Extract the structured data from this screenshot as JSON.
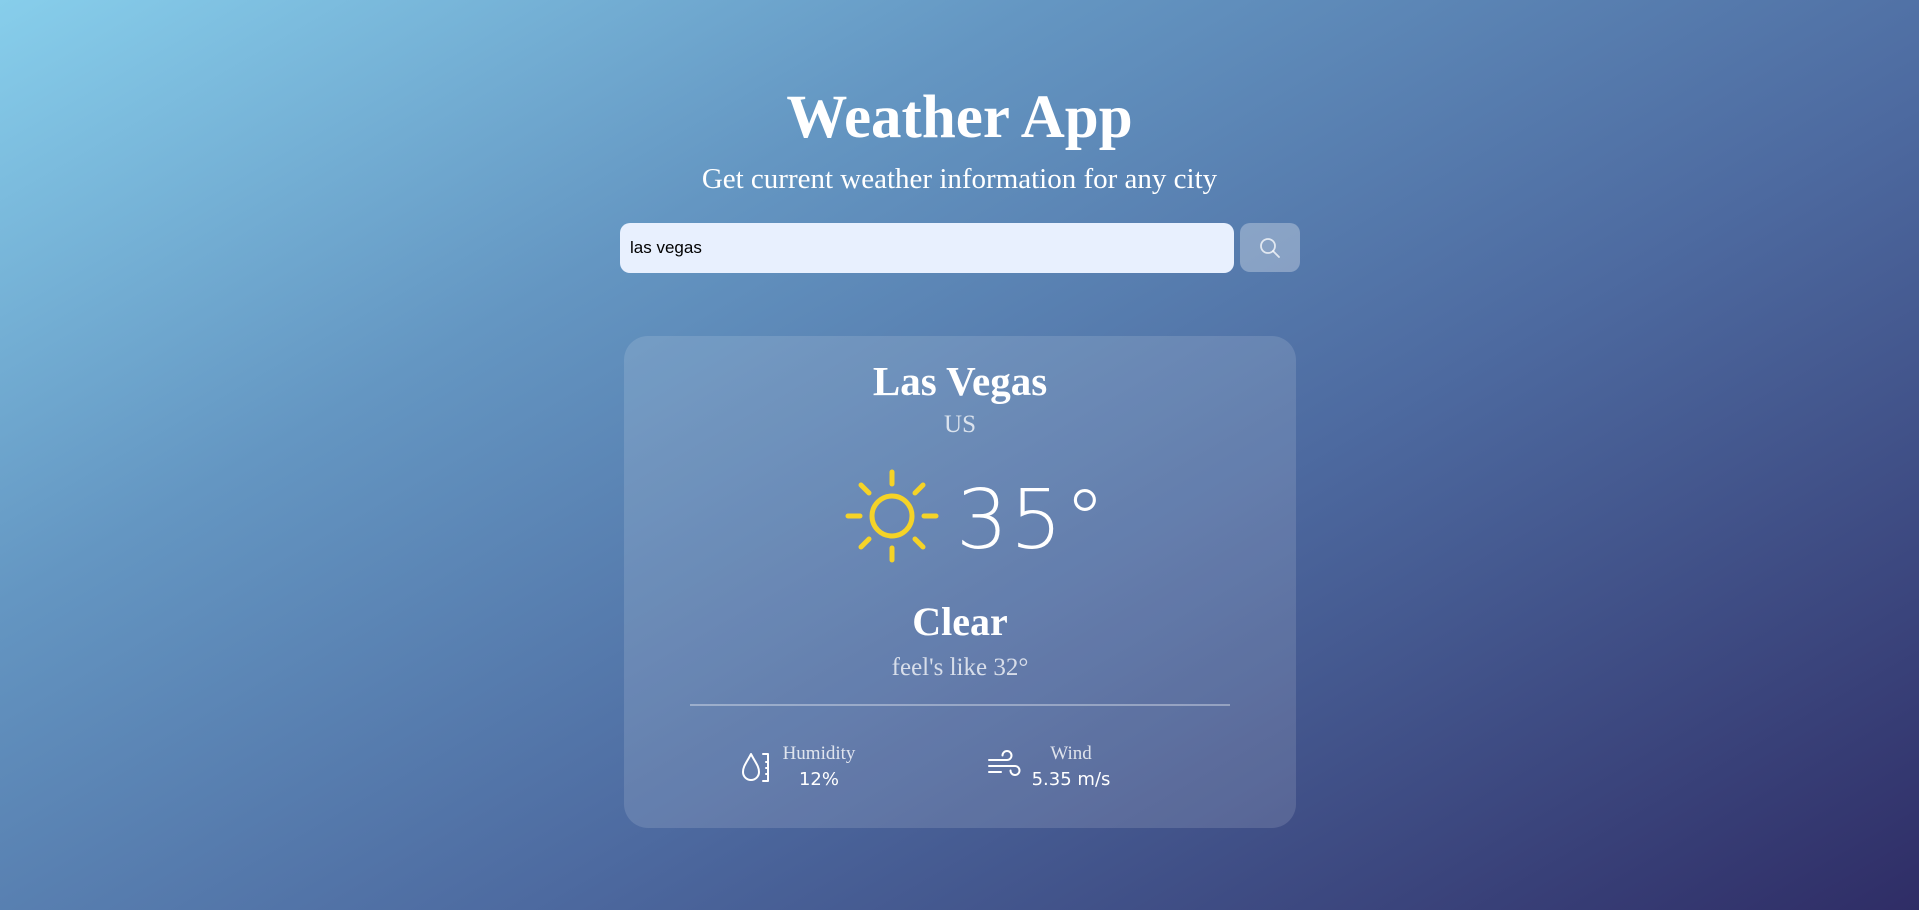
{
  "header": {
    "title": "Weather App",
    "subtitle": "Get current weather information for any city"
  },
  "search": {
    "value": "las vegas",
    "placeholder": "",
    "button_icon": "search-icon"
  },
  "weather": {
    "city": "Las Vegas",
    "country": "US",
    "icon": "sun-icon",
    "temperature": "35°",
    "condition": "Clear",
    "feels_like": "feel's like 32°",
    "humidity": {
      "label": "Humidity",
      "value": "12%",
      "icon": "humidity-icon"
    },
    "wind": {
      "label": "Wind",
      "value": "5.35 m/s",
      "icon": "wind-icon"
    }
  },
  "colors": {
    "sun": "#f5d327",
    "background_top": "#87ceeb",
    "background_bottom": "#2f2d66"
  }
}
